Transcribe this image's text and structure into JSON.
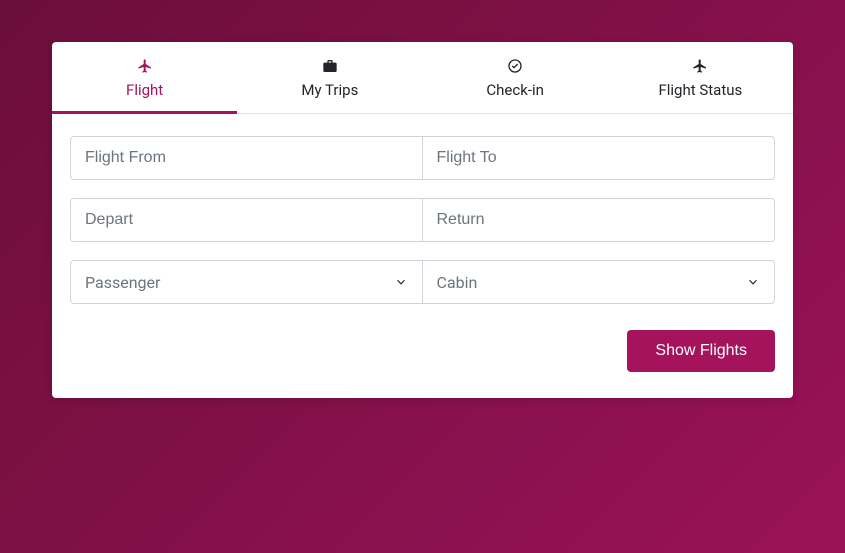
{
  "colors": {
    "accent": "#a5135c"
  },
  "tabs": [
    {
      "label": "Flight",
      "active": true
    },
    {
      "label": "My Trips",
      "active": false
    },
    {
      "label": "Check-in",
      "active": false
    },
    {
      "label": "Flight Status",
      "active": false
    }
  ],
  "form": {
    "from_placeholder": "Flight From",
    "to_placeholder": "Flight To",
    "depart_placeholder": "Depart",
    "return_placeholder": "Return",
    "passenger_label": "Passenger",
    "cabin_label": "Cabin",
    "submit_label": "Show Flights"
  }
}
